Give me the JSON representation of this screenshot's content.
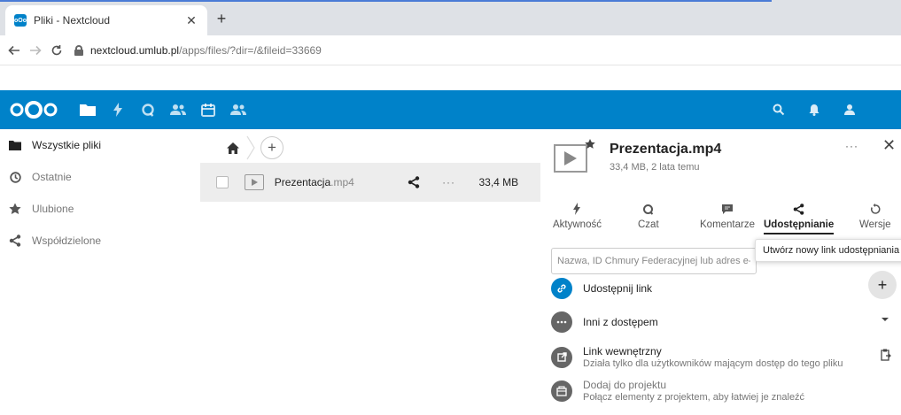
{
  "browser": {
    "tab_title": "Pliki - Nextcloud",
    "tab_favicon_text": "oOo",
    "url_host": "nextcloud.umlub.pl",
    "url_path": "/apps/files/?dir=/&fileid=33669"
  },
  "colors": {
    "brand": "#0082c9",
    "accent_tab": "#4a7bd6",
    "row_selected": "#ededed",
    "icon_grey": "#666666"
  },
  "header": {
    "apps": [
      "files-icon",
      "activity-icon",
      "talk-icon",
      "contacts-icon",
      "calendar-icon",
      "circles-icon"
    ],
    "right": [
      "search-icon",
      "notifications-icon",
      "contacts-menu-icon"
    ]
  },
  "navigation": {
    "items": [
      {
        "label": "Wszystkie pliki",
        "icon": "folder-icon",
        "active": true
      },
      {
        "label": "Ostatnie",
        "icon": "clock-icon",
        "active": false
      },
      {
        "label": "Ulubione",
        "icon": "star-icon",
        "active": false
      },
      {
        "label": "Współdzielone",
        "icon": "share-icon",
        "active": false
      }
    ]
  },
  "files": {
    "rows": [
      {
        "name": "Prezentacja",
        "ext": ".mp4",
        "more": "···",
        "size": "33,4 MB"
      }
    ],
    "add_label": "+"
  },
  "sidebar": {
    "title": "Prezentacja.mp4",
    "subtitle": "33,4 MB, 2 lata temu",
    "more": "···",
    "close": "✕",
    "tabs": [
      {
        "label": "Aktywność",
        "icon": "activity-icon",
        "active": false
      },
      {
        "label": "Czat",
        "icon": "talk-icon",
        "active": false
      },
      {
        "label": "Komentarze",
        "icon": "comment-icon",
        "active": false
      },
      {
        "label": "Udostępnianie",
        "icon": "share-icon",
        "active": true
      },
      {
        "label": "Wersje",
        "icon": "history-icon",
        "active": false
      }
    ],
    "share_input_placeholder": "Nazwa, ID Chmury Federacyjnej lub adres e-mail",
    "tooltip": "Utwórz nowy link udostępniania",
    "share_link_label": "Udostępnij link",
    "others_label": "Inni z dostępem",
    "internal_link_title": "Link wewnętrzny",
    "internal_link_desc": "Działa tylko dla użytkowników mającym dostęp do tego pliku",
    "project_title": "Dodaj do projektu",
    "project_desc": "Połącz elementy z projektem, aby łatwiej je znaleźć",
    "plus": "+"
  }
}
